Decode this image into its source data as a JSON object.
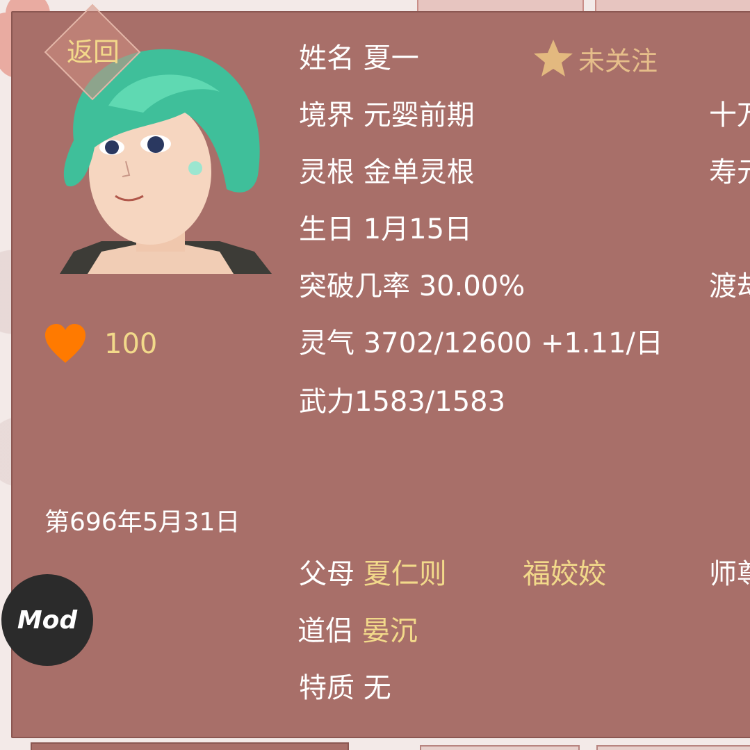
{
  "back_button": {
    "label": "返回"
  },
  "character": {
    "name_label": "姓名",
    "name": "夏一",
    "follow_status": "未关注",
    "realm_label": "境界",
    "realm": "元婴前期",
    "root_label": "灵根",
    "root": "金单灵根",
    "birthday_label": "生日",
    "birthday": "1月15日",
    "breakthrough_label": "突破几率",
    "breakthrough": "30.00%",
    "qi_label": "灵气",
    "qi": "3702/12600 +1.11/日",
    "power_label": "武力",
    "power": "1583/1583",
    "favor": "100",
    "parents_label": "父母",
    "father": "夏仁则",
    "mother": "福姣姣",
    "partner_label": "道侣",
    "partner": "晏沉",
    "trait_label": "特质",
    "trait": "无"
  },
  "right_column_clipped": {
    "row1": "十万",
    "row2": "寿元",
    "row3": "渡劫",
    "row4": "师尊"
  },
  "game_date": "第696年5月31日",
  "mod_button": {
    "label": "Mod"
  },
  "colors": {
    "panel": "#a86f69",
    "gold_text": "#f2d98a",
    "heart": "#ff7a00",
    "star": "#e3b97f"
  },
  "icons": [
    "star-icon",
    "heart-icon"
  ]
}
